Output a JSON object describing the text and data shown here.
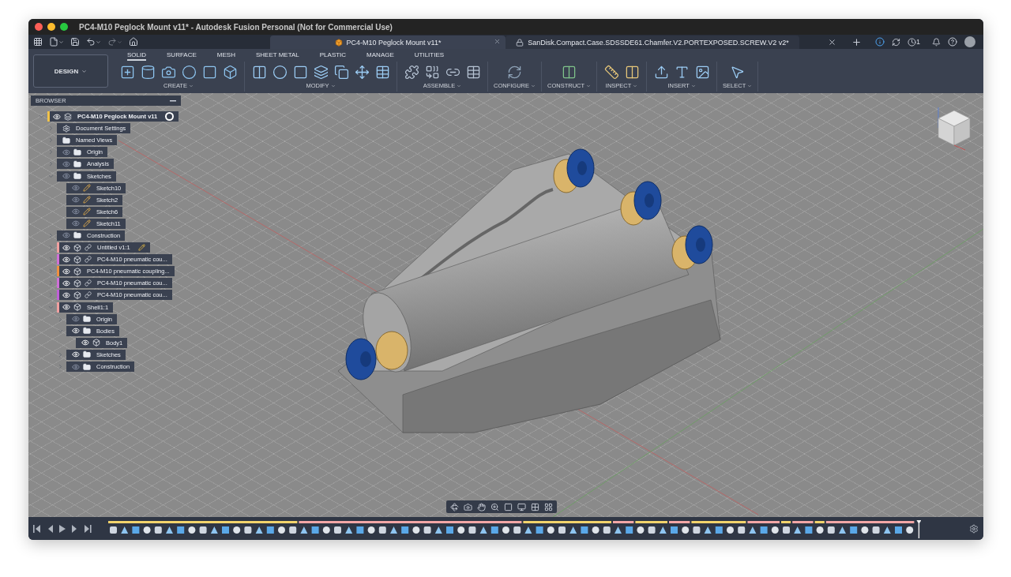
{
  "window": {
    "title": "PC4-M10 Peglock Mount v11* - Autodesk Fusion Personal (Not for Commercial Use)"
  },
  "toolbar": {
    "notification_count": "1"
  },
  "document_tabs": [
    {
      "title": "PC4-M10 Peglock Mount v11*",
      "selected": true,
      "kind": "design"
    },
    {
      "title": "SanDisk.Compact.Case.SDSSDE61.Chamfer.V2.PORTEXPOSED.SCREW.V2 v2*",
      "selected": false,
      "kind": "locked"
    }
  ],
  "ribbon": {
    "workspace": "DESIGN",
    "tabs": [
      {
        "label": "SOLID",
        "selected": true
      },
      {
        "label": "SURFACE",
        "selected": false
      },
      {
        "label": "MESH",
        "selected": false
      },
      {
        "label": "SHEET METAL",
        "selected": false
      },
      {
        "label": "PLASTIC",
        "selected": false
      },
      {
        "label": "MANAGE",
        "selected": false
      },
      {
        "label": "UTILITIES",
        "selected": false
      }
    ],
    "groups": [
      {
        "label": "CREATE"
      },
      {
        "label": "MODIFY"
      },
      {
        "label": "ASSEMBLE"
      },
      {
        "label": "CONFIGURE"
      },
      {
        "label": "CONSTRUCT"
      },
      {
        "label": "INSPECT"
      },
      {
        "label": "INSERT"
      },
      {
        "label": "SELECT"
      }
    ]
  },
  "browser": {
    "title": "BROWSER",
    "tree": [
      {
        "label": "PC4-M10 Peglock Mount v11",
        "kind": "assembly",
        "visible": true,
        "expanded": true,
        "active": true,
        "color": "#f0c24a",
        "children": [
          {
            "label": "Document Settings",
            "kind": "settings",
            "expanded": false
          },
          {
            "label": "Named Views",
            "kind": "folder",
            "expanded": false
          },
          {
            "label": "Origin",
            "kind": "folder",
            "visible": false,
            "expanded": false
          },
          {
            "label": "Analysis",
            "kind": "folder",
            "visible": false,
            "expanded": false
          },
          {
            "label": "Sketches",
            "kind": "folder",
            "visible": false,
            "expanded": true,
            "children": [
              {
                "label": "Sketch10",
                "kind": "sketch",
                "visible": false
              },
              {
                "label": "Sketch2",
                "kind": "sketch",
                "visible": false
              },
              {
                "label": "Sketch6",
                "kind": "sketch",
                "visible": false
              },
              {
                "label": "Sketch11",
                "kind": "sketch",
                "visible": false
              }
            ]
          },
          {
            "label": "Construction",
            "kind": "folder",
            "visible": false,
            "expanded": false
          },
          {
            "label": "Untitled v1:1",
            "kind": "component",
            "visible": true,
            "expanded": false,
            "linked": true,
            "editing": true,
            "color": "#f0a0a0"
          },
          {
            "label": "PC4-M10 pneumatic cou...",
            "kind": "component",
            "visible": true,
            "expanded": false,
            "linked": true,
            "color": "#d070d8"
          },
          {
            "label": "PC4-M10 pneumatic coupling...",
            "kind": "component",
            "visible": true,
            "expanded": false,
            "linked": false,
            "color": "#f09040"
          },
          {
            "label": "PC4-M10 pneumatic cou...",
            "kind": "component",
            "visible": true,
            "expanded": false,
            "linked": true,
            "color": "#d070d8"
          },
          {
            "label": "PC4-M10 pneumatic cou...",
            "kind": "component",
            "visible": true,
            "expanded": false,
            "linked": true,
            "color": "#c060d8"
          },
          {
            "label": "Shell1:1",
            "kind": "component",
            "visible": true,
            "expanded": true,
            "linked": false,
            "color": "#f0a0a0",
            "children": [
              {
                "label": "Origin",
                "kind": "folder",
                "visible": false,
                "expanded": false
              },
              {
                "label": "Bodies",
                "kind": "folder",
                "visible": true,
                "expanded": true,
                "children": [
                  {
                    "label": "Body1",
                    "kind": "body",
                    "visible": true
                  }
                ]
              },
              {
                "label": "Sketches",
                "kind": "folder",
                "visible": true,
                "expanded": false
              },
              {
                "label": "Construction",
                "kind": "folder",
                "visible": false,
                "expanded": false
              }
            ]
          }
        ]
      }
    ]
  }
}
